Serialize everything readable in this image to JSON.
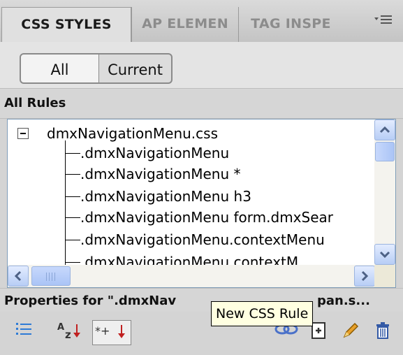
{
  "tabs": [
    {
      "label": "CSS STYLES",
      "active": true
    },
    {
      "label": "AP ELEMEN",
      "active": false
    },
    {
      "label": "TAG INSPE",
      "active": false
    }
  ],
  "panel_menu_icon": "panel-options-menu-icon",
  "view_toggle": {
    "all_label": "All",
    "current_label": "Current",
    "selected": "All"
  },
  "all_rules": {
    "header": "All Rules",
    "stylesheet": "dmxNavigationMenu.css",
    "rules": [
      ".dmxNavigationMenu",
      ".dmxNavigationMenu *",
      ".dmxNavigationMenu h3",
      ".dmxNavigationMenu form.dmxSear",
      ".dmxNavigationMenu.contextMenu",
      ".dmxNavigationMenu.contextM"
    ]
  },
  "properties": {
    "header": "Properties for \".dmxNav",
    "header_tail": "pan.s..."
  },
  "tooltip": "New CSS Rule",
  "toolbar": {
    "left": [
      "category-view-icon",
      "alphabetical-sort-icon",
      "set-properties-only-icon"
    ],
    "right": [
      "attach-stylesheet-icon",
      "new-css-rule-icon",
      "edit-rule-icon",
      "delete-rule-icon"
    ]
  },
  "colors": {
    "accent_blue": "#4a71c9",
    "tooltip_bg": "#ffffe1",
    "tree_border": "#7f9db9"
  }
}
